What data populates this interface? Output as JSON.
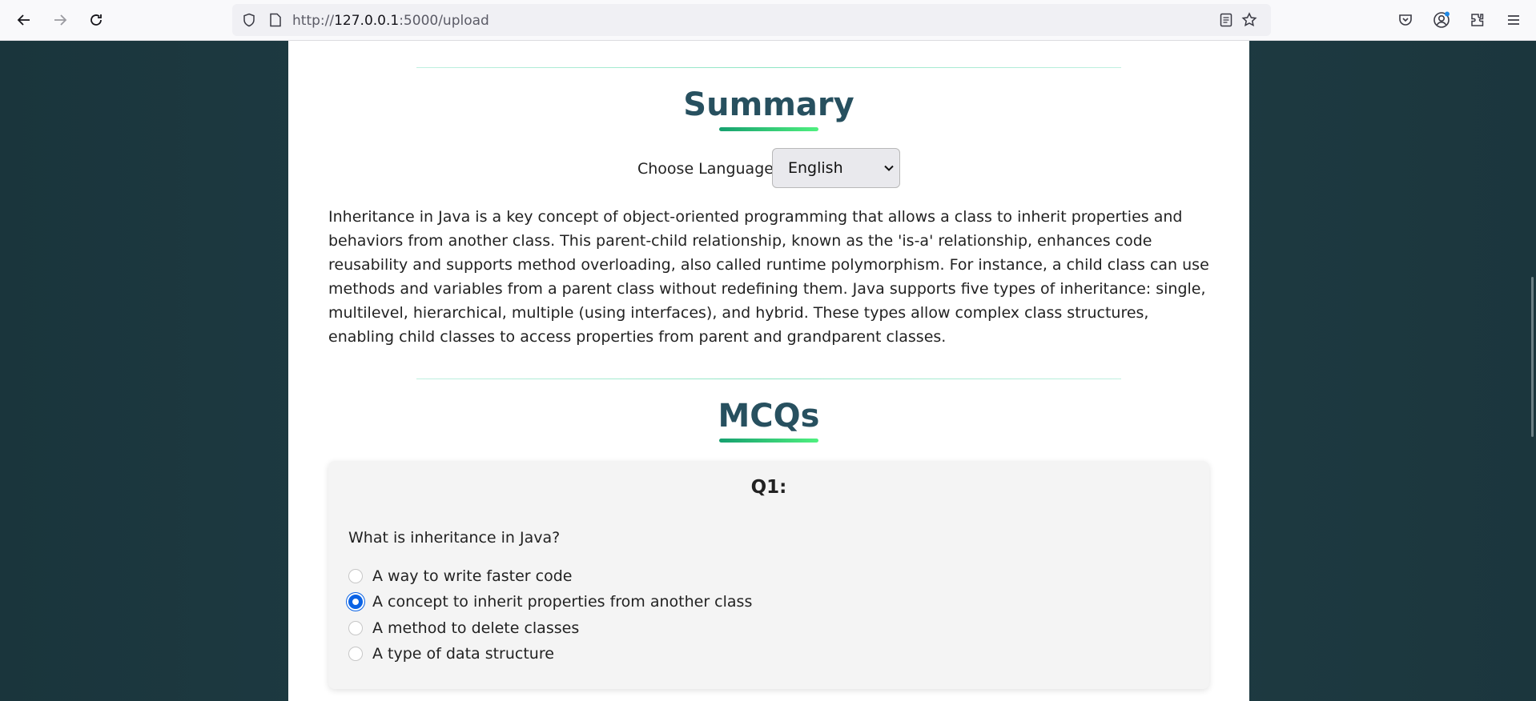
{
  "browser": {
    "url_prefix": "http://",
    "url_host": "127.0.0.1",
    "url_path": ":5000/upload"
  },
  "summary": {
    "heading": "Summary",
    "language_label": "Choose Language:",
    "language_selected": "English",
    "text": "Inheritance in Java is a key concept of object-oriented programming that allows a class to inherit properties and behaviors from another class. This parent-child relationship, known as the 'is-a' relationship, enhances code reusability and supports method overloading, also called runtime polymorphism. For instance, a child class can use methods and variables from a parent class without redefining them. Java supports five types of inheritance: single, multilevel, hierarchical, multiple (using interfaces), and hybrid. These types allow complex class structures, enabling child classes to access properties from parent and grandparent classes."
  },
  "mcqs": {
    "heading": "MCQs",
    "questions": [
      {
        "number": "Q1:",
        "question": "What is inheritance in Java?",
        "options": [
          "A way to write faster code",
          "A concept to inherit properties from another class",
          "A method to delete classes",
          "A type of data structure"
        ],
        "selected_index": 1
      }
    ]
  },
  "colors": {
    "heading": "#27505f",
    "accent": "#16a06f",
    "radio_checked": "#0b63e5"
  }
}
